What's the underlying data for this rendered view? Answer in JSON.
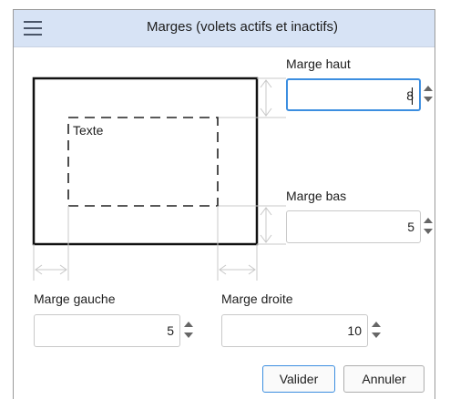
{
  "dialog": {
    "title": "Marges (volets actifs et inactifs)"
  },
  "preview": {
    "inner_text": "Texte"
  },
  "fields": {
    "top": {
      "label": "Marge haut",
      "value": "8"
    },
    "bottom": {
      "label": "Marge bas",
      "value": "5"
    },
    "left": {
      "label": "Marge gauche",
      "value": "5"
    },
    "right": {
      "label": "Marge droite",
      "value": "10"
    }
  },
  "buttons": {
    "ok_label": "Valider",
    "cancel_label": "Annuler"
  },
  "colors": {
    "titlebar": "#d7e3f5",
    "focus_border": "#3c8ee0"
  },
  "icons": {
    "menu": "hamburger-menu-icon",
    "stepper_up": "chevron-up-icon",
    "stepper_down": "chevron-down-icon"
  }
}
